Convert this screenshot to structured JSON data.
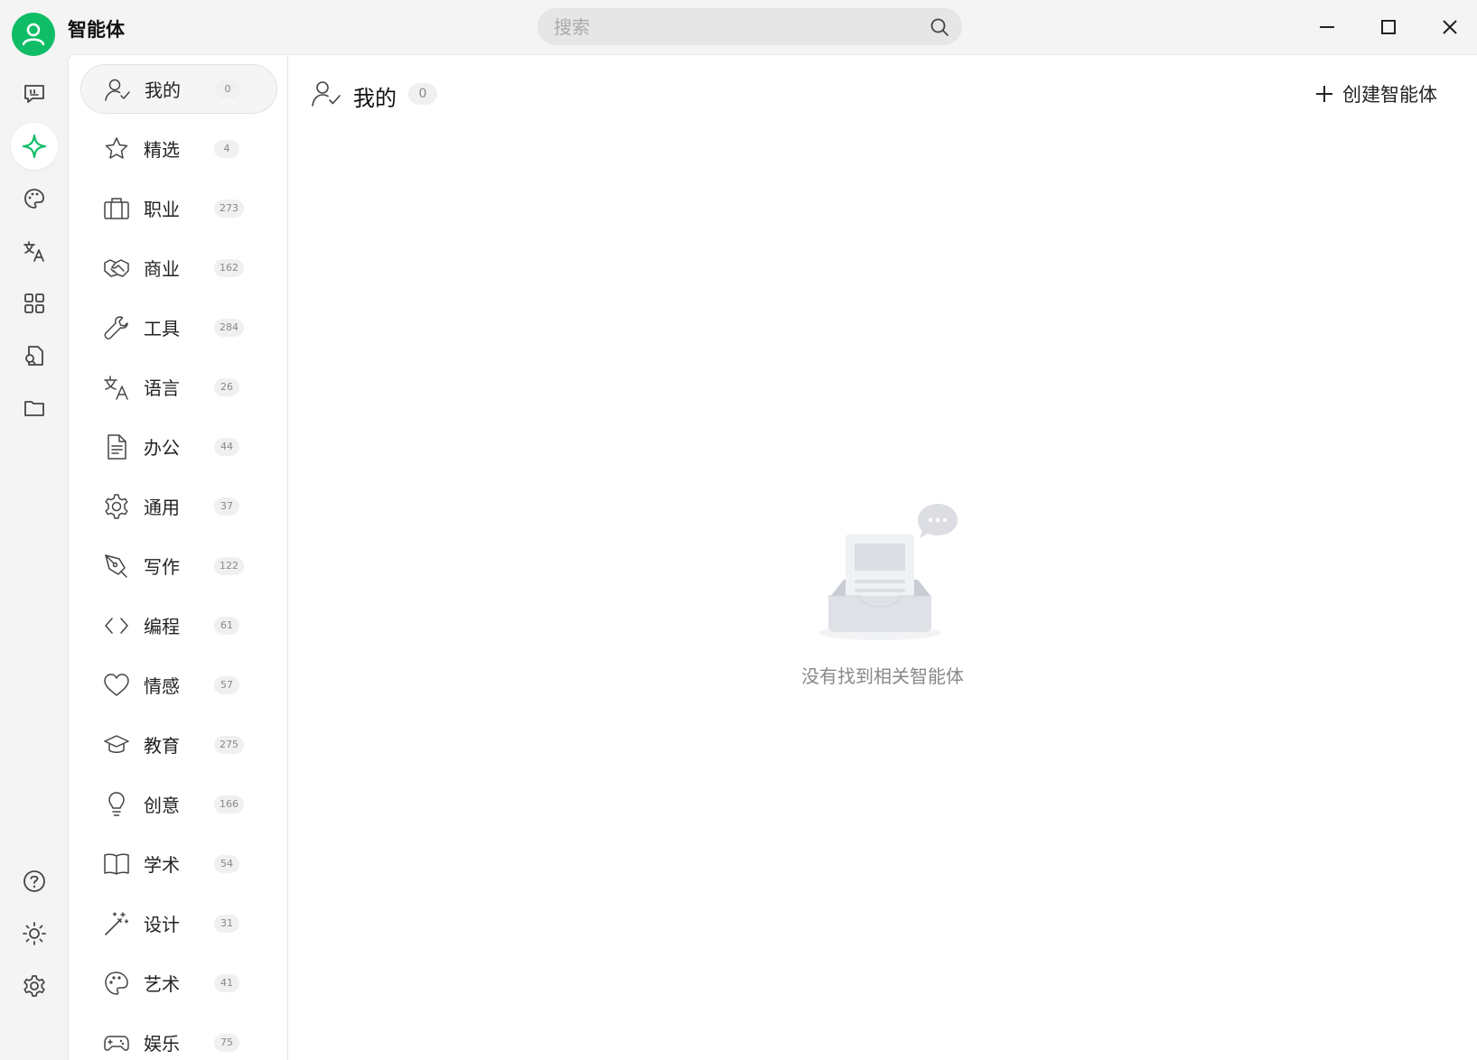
{
  "window": {
    "title": "智能体"
  },
  "search": {
    "placeholder": "搜索",
    "value": ""
  },
  "rail": {
    "top": [
      "chat-icon",
      "agent-sparkle-icon",
      "palette-icon",
      "translate-icon",
      "apps-grid-icon",
      "doc-search-icon",
      "folder-icon"
    ],
    "bottom": [
      "help-icon",
      "theme-sun-icon",
      "settings-gear-icon"
    ],
    "active": "agent-sparkle-icon",
    "accent": "#0fbd66"
  },
  "categories": [
    {
      "label": "我的",
      "count": "0",
      "icon": "user-check-icon"
    },
    {
      "label": "精选",
      "count": "4",
      "icon": "star-icon"
    },
    {
      "label": "职业",
      "count": "273",
      "icon": "briefcase-icon"
    },
    {
      "label": "商业",
      "count": "162",
      "icon": "handshake-icon"
    },
    {
      "label": "工具",
      "count": "284",
      "icon": "wrench-icon"
    },
    {
      "label": "语言",
      "count": "26",
      "icon": "translate-icon"
    },
    {
      "label": "办公",
      "count": "44",
      "icon": "document-icon"
    },
    {
      "label": "通用",
      "count": "37",
      "icon": "gear-icon"
    },
    {
      "label": "写作",
      "count": "122",
      "icon": "pen-icon"
    },
    {
      "label": "编程",
      "count": "61",
      "icon": "code-icon"
    },
    {
      "label": "情感",
      "count": "57",
      "icon": "heart-icon"
    },
    {
      "label": "教育",
      "count": "275",
      "icon": "graduation-cap-icon"
    },
    {
      "label": "创意",
      "count": "166",
      "icon": "lightbulb-icon"
    },
    {
      "label": "学术",
      "count": "54",
      "icon": "book-icon"
    },
    {
      "label": "设计",
      "count": "31",
      "icon": "magic-wand-icon"
    },
    {
      "label": "艺术",
      "count": "41",
      "icon": "palette-icon"
    },
    {
      "label": "娱乐",
      "count": "75",
      "icon": "gamepad-icon"
    }
  ],
  "main": {
    "title": "我的",
    "count": "0",
    "create_label": "创建智能体",
    "empty_text": "没有找到相关智能体"
  }
}
